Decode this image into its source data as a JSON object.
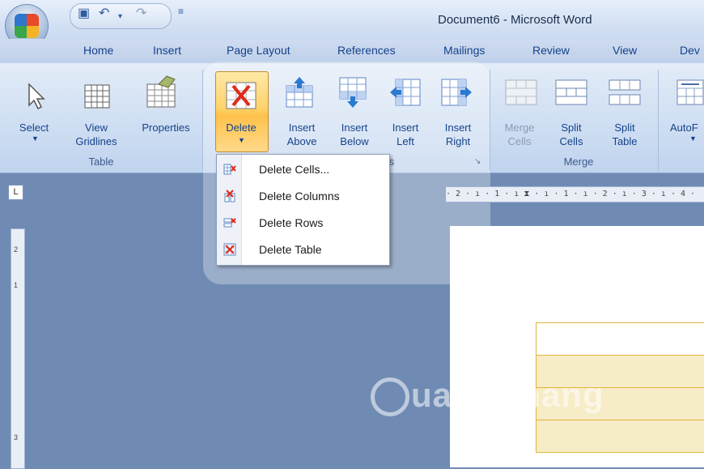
{
  "window": {
    "title": "Document6 - Microsoft Word"
  },
  "qat": {
    "save_icon": "save-icon",
    "undo_icon": "undo-icon",
    "redo_icon": "redo-icon",
    "customize_icon": "customize-qat-icon"
  },
  "tabs": [
    "Home",
    "Insert",
    "Page Layout",
    "References",
    "Mailings",
    "Review",
    "View",
    "Dev"
  ],
  "ribbon": {
    "table_group": {
      "label": "Table",
      "buttons": [
        "Select",
        "View\nGridlines",
        "Properties"
      ]
    },
    "rows_columns_group": {
      "label": "s",
      "buttons": [
        "Delete",
        "Insert\nAbove",
        "Insert\nBelow",
        "Insert\nLeft",
        "Insert\nRight"
      ]
    },
    "merge_group": {
      "label": "Merge",
      "buttons": [
        "Merge\nCells",
        "Split\nCells",
        "Split\nTable"
      ]
    },
    "autofit": "AutoF"
  },
  "delete_menu": {
    "items": [
      "Delete Cells...",
      "Delete Columns",
      "Delete Rows",
      "Delete Table"
    ]
  },
  "ruler": {
    "corner": "L",
    "horizontal": "· 2 · ı · 1 · ı ⧗ · ı · 1 · ı · 2 · ı · 3 · ı · 4 ·",
    "vertical": [
      "2",
      "1",
      "3"
    ]
  },
  "watermark": "uantrimang",
  "colors": {
    "accent": "#15428b",
    "highlight": "#ffd36b",
    "table_border": "#e0b53a"
  }
}
